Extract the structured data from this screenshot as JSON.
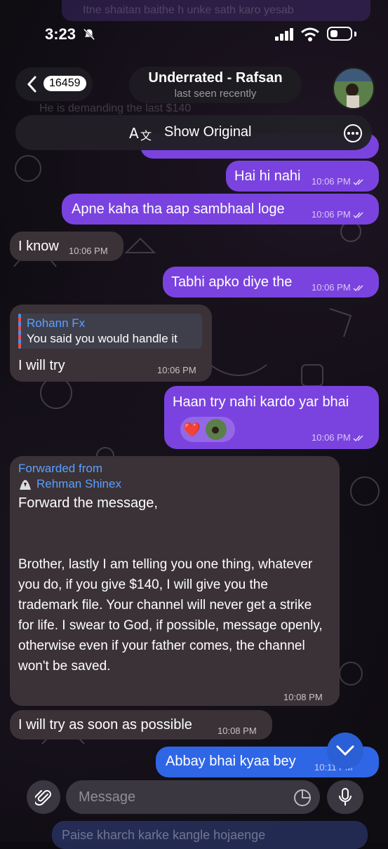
{
  "status_bar": {
    "time": "3:23"
  },
  "ghost_text": {
    "top": "Itne shaitan baithe h unke sath karo yesab",
    "mid": "He is demanding the last $140",
    "bottom": "Paise kharch karke kangle hojaenge"
  },
  "header": {
    "back_count": "16459",
    "title": "Underrated - Rafsan",
    "subtitle": "last seen recently"
  },
  "translate_bar": {
    "label": "Show Original"
  },
  "messages": [
    {
      "text": "Hai hi nahi",
      "time": "10:06 PM"
    },
    {
      "text": "Apne kaha tha aap sambhaal loge",
      "time": "10:06 PM"
    },
    {
      "text": "I know",
      "time": "10:06 PM"
    },
    {
      "text": "Tabhi apko diye the",
      "time": "10:06 PM"
    },
    {
      "reply_name": "Rohann Fx",
      "reply_text": "You said you would handle it",
      "text": "I will try",
      "time": "10:06 PM"
    },
    {
      "text": "Haan try nahi kardo yar bhai",
      "time": "10:06 PM",
      "reaction": "❤️"
    },
    {
      "forward_label": "Forwarded from",
      "forward_name": "Rehman Shinex",
      "text1": "Forward the message,",
      "text2": "Brother, lastly I am telling you one thing, whatever you do, if you give $140, I will give you the trademark file. Your channel will never get a strike for life. I swear to God, if possible, message openly, otherwise even if your father comes, the channel won't be saved.",
      "time": "10:08 PM"
    },
    {
      "text": "I will try as soon as possible",
      "time": "10:08 PM"
    },
    {
      "text": "Abbay bhai kyaa bey",
      "time": "10:11 PM"
    }
  ],
  "composer": {
    "placeholder": "Message"
  },
  "colors": {
    "outgoing": "#7a43df",
    "incoming": "#3a3237",
    "accent": "#2f66e6"
  }
}
